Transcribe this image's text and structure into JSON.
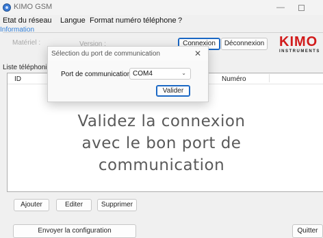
{
  "window": {
    "title": "KIMO GSM",
    "minimize_glyph": "—"
  },
  "menu": [
    "Etat du réseau",
    "Langue",
    "Format numéro téléphone",
    "?"
  ],
  "information": {
    "legend": "Information",
    "hardware_label": "Matériel :",
    "version_label": "Version :",
    "connect_button": "Connexion",
    "disconnect_button": "Déconnexion"
  },
  "logo": {
    "main": "KIMO",
    "sub": "INSTRUMENTS"
  },
  "phone_list": {
    "title": "Liste téléphoni",
    "columns": [
      "ID",
      "Numéro"
    ]
  },
  "overlay_text": [
    "Validez la connexion",
    "avec le bon port de",
    "communication"
  ],
  "actions": {
    "add": "Ajouter",
    "edit": "Editer",
    "delete": "Supprimer"
  },
  "footer": {
    "send_config": "Envoyer la configuration",
    "quit": "Quitter"
  },
  "dialog": {
    "title": "Sélection du port de communication",
    "close_glyph": "✕",
    "port_label": "Port de communication :",
    "port_value": "COM4",
    "validate_button": "Valider"
  },
  "colors": {
    "legend": "#2f7ed8",
    "logo_red": "#d11a1a",
    "focus_blue": "#1a67c4"
  },
  "icons": [
    "app-icon",
    "chevron-down-icon",
    "close-icon",
    "minimize-icon",
    "maximize-icon"
  ]
}
